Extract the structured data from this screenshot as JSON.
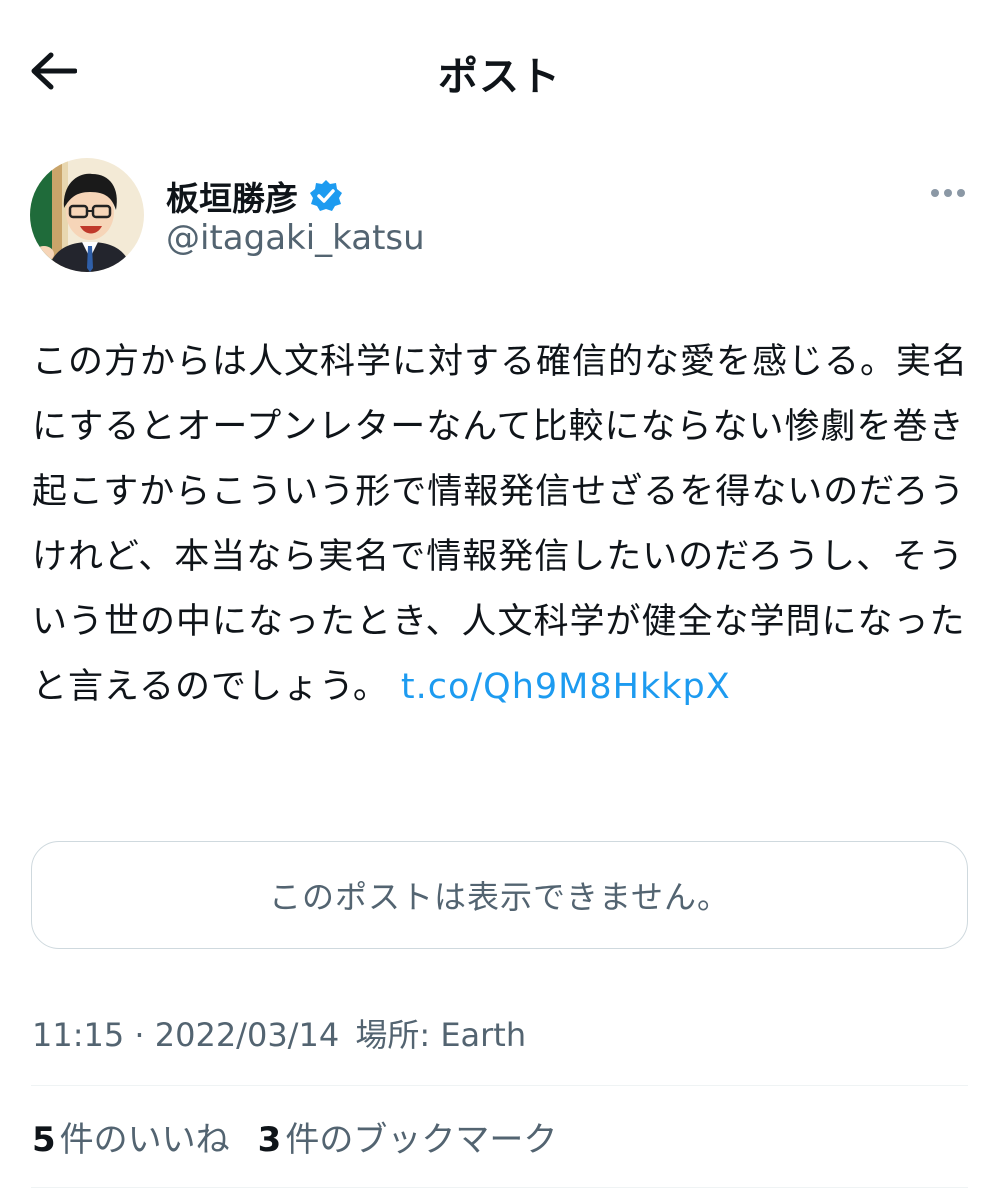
{
  "header": {
    "title": "ポスト",
    "back_icon": "arrow-left-icon"
  },
  "author": {
    "display_name": "板垣勝彦",
    "handle": "@itagaki_katsu",
    "verified_icon": "verified-badge-icon",
    "more_icon": "more-horizontal-icon"
  },
  "post": {
    "text": "この方からは人文科学に対する確信的な愛を感じる。実名にするとオープンレターなんて比較にならない惨劇を巻き起こすからこういう形で情報発信せざるを得ないのだろうけれど、本当なら実名で情報発信したいのだろうし、そういう世の中になったとき、人文科学が健全な学問になったと言えるのでしょう。",
    "link": "t.co/Qh9M8HkkpX",
    "quoted_unavailable": "このポストは表示できません。"
  },
  "meta": {
    "time": "11:15",
    "separator": "·",
    "date": "2022/03/14",
    "location_label": "場所:",
    "location": "Earth"
  },
  "engagement": {
    "likes_count": "5",
    "likes_label": "件のいいね",
    "bookmarks_count": "3",
    "bookmarks_label": "件のブックマーク"
  },
  "colors": {
    "link": "#1d9bf0",
    "secondary_text": "#536471",
    "border": "#cfd9de",
    "verified": "#1d9bf0"
  }
}
